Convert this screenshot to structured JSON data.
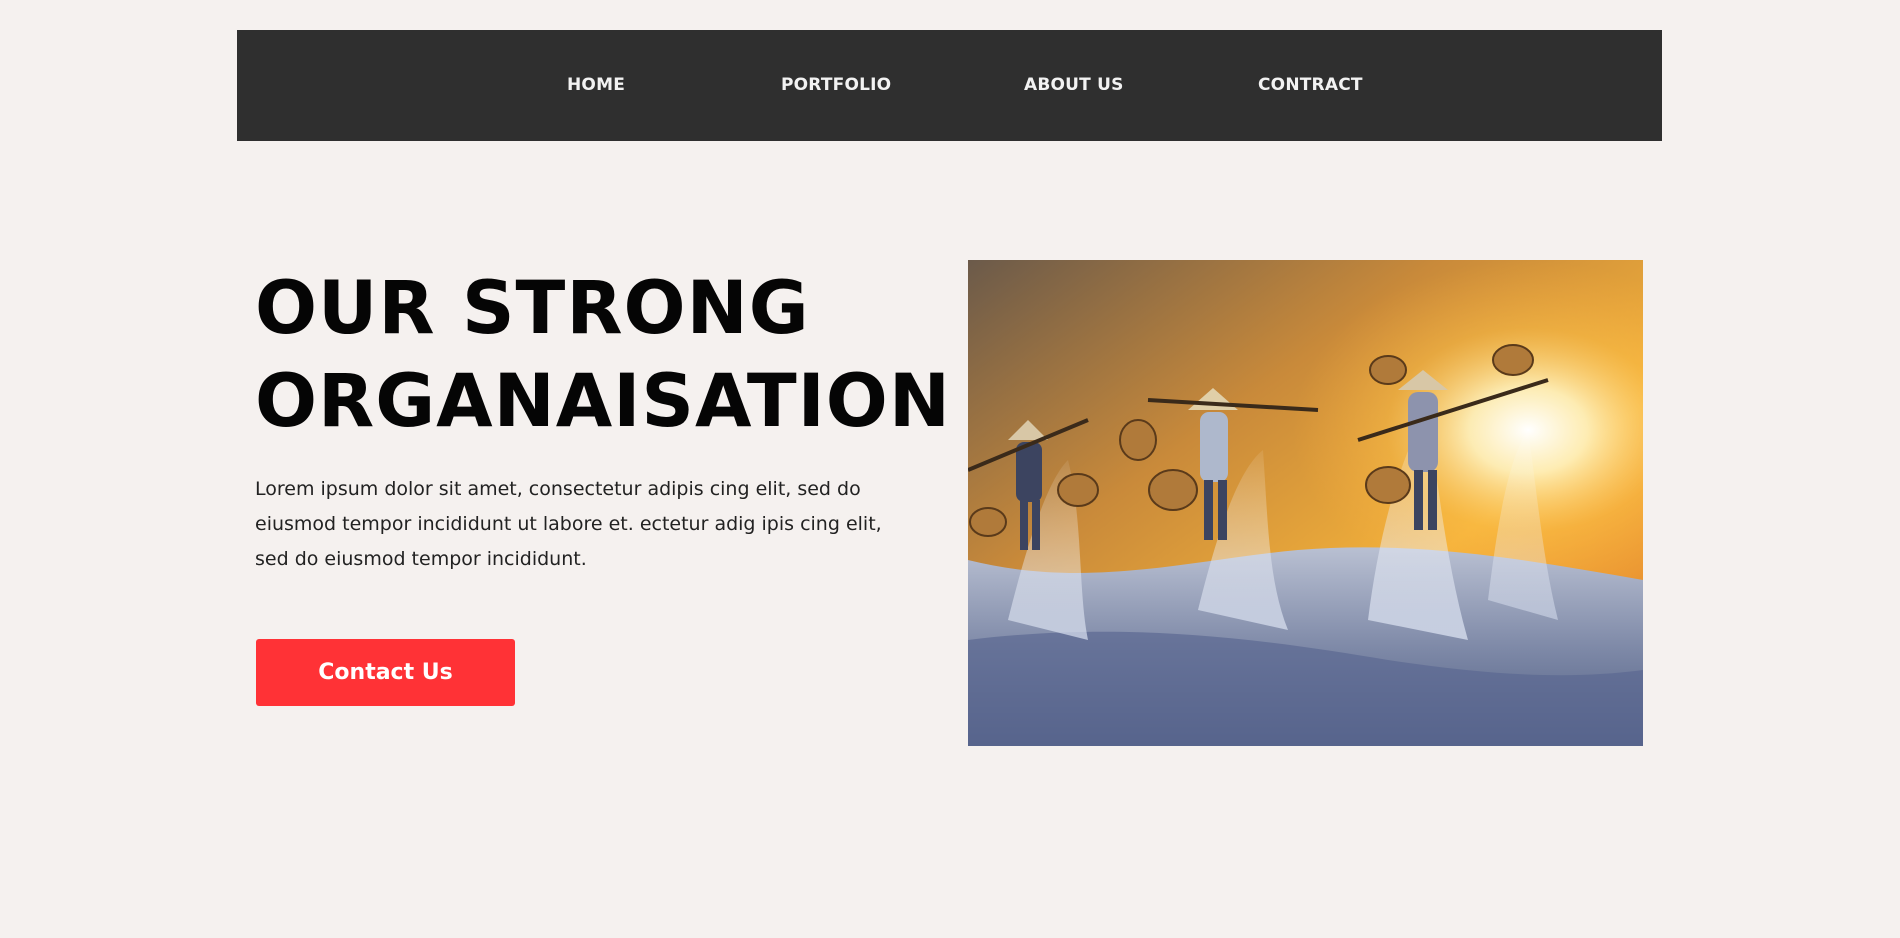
{
  "nav": {
    "items": [
      {
        "label": "HOME"
      },
      {
        "label": "PORTFOLIO"
      },
      {
        "label": "ABOUT US"
      },
      {
        "label": "CONTRACT"
      }
    ]
  },
  "hero": {
    "title_line1": "OUR STRONG",
    "title_line2": "ORGANAISATION",
    "body": "Lorem ipsum dolor sit amet, consectetur adipis cing elit, sed do eiusmod tempor incididunt ut labore et. ectetur adig ipis cing elit, sed do eiusmod tempor incididunt.",
    "button_label": "Contact Us",
    "image_alt": "salt-field-workers-at-sunrise-photo"
  },
  "colors": {
    "background": "#f5f1ef",
    "navbar": "#2f2f2f",
    "nav_text": "#f2f2f2",
    "accent": "#ff3236",
    "heading": "#050505"
  }
}
